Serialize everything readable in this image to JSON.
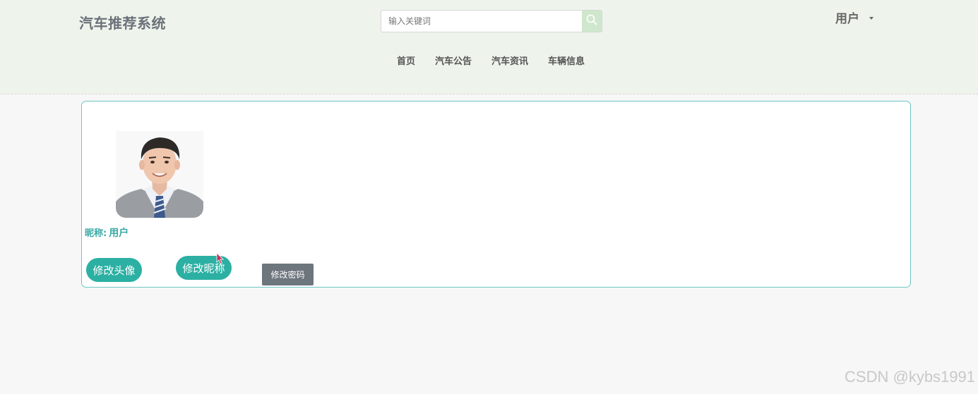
{
  "header": {
    "brand": "汽车推荐系统",
    "search_placeholder": "输入关键词",
    "user_label": "用户"
  },
  "nav": {
    "items": [
      "首页",
      "汽车公告",
      "汽车资讯",
      "车辆信息"
    ]
  },
  "profile": {
    "nickname_label": "昵称:",
    "nickname_value": "用户",
    "change_avatar_label": "修改头像",
    "change_nickname_label": "修改昵称",
    "change_password_label": "修改密码"
  },
  "watermark": "CSDN @kybs1991",
  "colors": {
    "accent": "#2bb0a3",
    "header_bg": "#eef4ec",
    "panel_border": "#6cc6c2",
    "gray_button": "#6d757d"
  },
  "icons": {
    "search": "search-icon",
    "caret": "caret-down-icon"
  }
}
